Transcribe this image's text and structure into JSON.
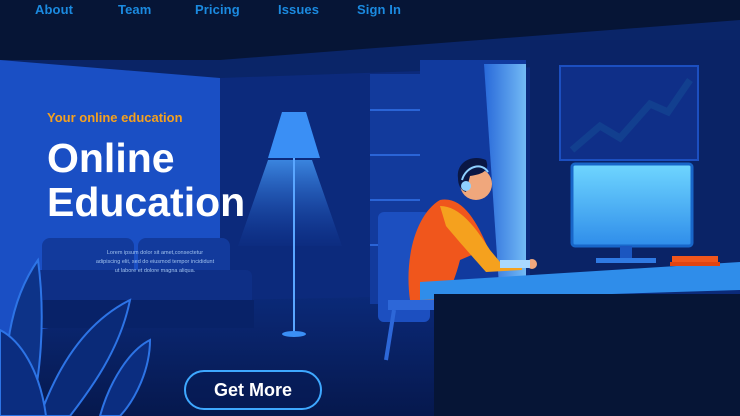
{
  "nav": {
    "items": [
      {
        "label": "About"
      },
      {
        "label": "Team"
      },
      {
        "label": "Pricing"
      },
      {
        "label": "Issues"
      },
      {
        "label": "Sign In"
      }
    ]
  },
  "hero": {
    "eyebrow": "Your online education",
    "title_line1": "Online",
    "title_line2": "Education",
    "blurb_line1": "Lorem ipsum dolor sit amet,consectetur",
    "blurb_line2": "adipiscing elit, sed do eiusmod tempor incididunt",
    "blurb_line3": "ut labore et dolore magna aliqua.",
    "cta_label": "Get More"
  },
  "colors": {
    "nav_text": "#1b8ae0",
    "eyebrow": "#f5a11e",
    "title": "#ffffff",
    "cta_border": "#3ea8ff",
    "background": "#0a2466",
    "accent_person_shirt": "#f0561c"
  },
  "icons": {
    "illustration": "student-at-computer-illustration"
  }
}
